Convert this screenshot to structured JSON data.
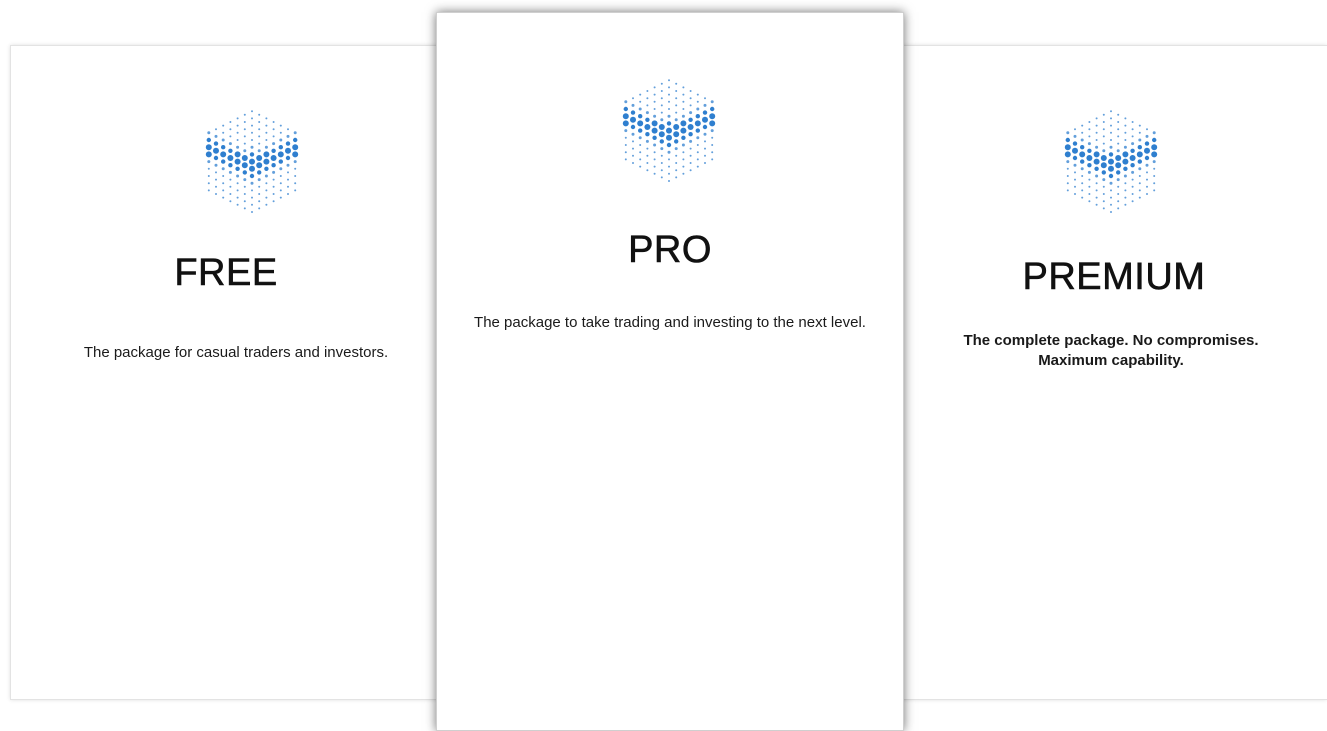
{
  "tiers": [
    {
      "name": "FREE",
      "description": "The package for casual traders and investors.",
      "icon": "hexagon-dots-logo-icon",
      "accent": "#2f7fcf"
    },
    {
      "name": "PRO",
      "description": "The package to take trading and investing to the next level.",
      "icon": "hexagon-dots-logo-icon",
      "accent": "#2f7fcf"
    },
    {
      "name": "PREMIUM",
      "description": "The complete package. No compromises. Maximum capability.",
      "icon": "hexagon-dots-logo-icon",
      "accent": "#2f7fcf"
    }
  ]
}
